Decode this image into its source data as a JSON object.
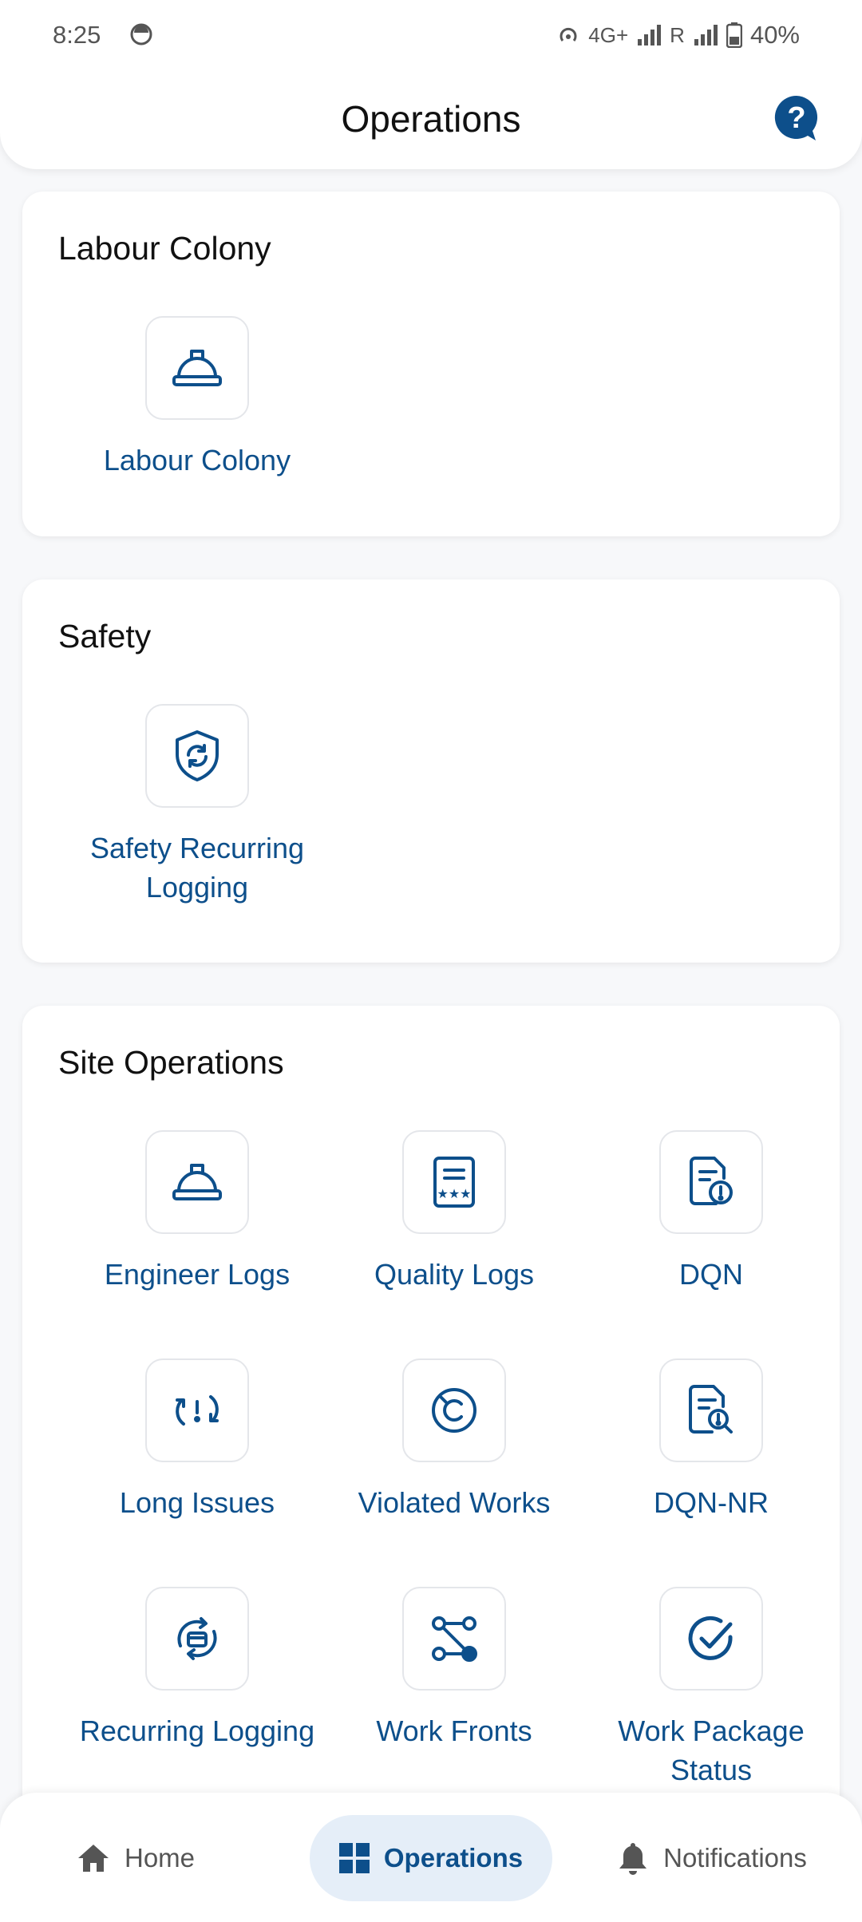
{
  "status_bar": {
    "time": "8:25",
    "network": "4G+",
    "roaming": "R",
    "battery": "40%"
  },
  "header": {
    "title": "Operations",
    "help_icon": "help-icon"
  },
  "sections": {
    "labour": {
      "title": "Labour Colony",
      "items": [
        {
          "label": "Labour Colony",
          "icon": "hard-hat-icon"
        }
      ]
    },
    "safety": {
      "title": "Safety",
      "items": [
        {
          "label": "Safety Recurring Logging",
          "icon": "shield-refresh-icon"
        }
      ]
    },
    "site": {
      "title": "Site Operations",
      "items": [
        {
          "label": "Engineer Logs",
          "icon": "hard-hat-icon"
        },
        {
          "label": "Quality Logs",
          "icon": "rating-document-icon"
        },
        {
          "label": "DQN",
          "icon": "document-alert-icon"
        },
        {
          "label": "Long Issues",
          "icon": "refresh-alert-icon"
        },
        {
          "label": "Violated Works",
          "icon": "copyright-slash-icon"
        },
        {
          "label": "DQN-NR",
          "icon": "document-search-icon"
        },
        {
          "label": "Recurring Logging",
          "icon": "recurring-box-icon"
        },
        {
          "label": "Work Fronts",
          "icon": "flow-nodes-icon"
        },
        {
          "label": "Work Package Status",
          "icon": "check-circle-icon"
        }
      ]
    }
  },
  "bottom_nav": {
    "home": "Home",
    "operations": "Operations",
    "notifications": "Notifications"
  },
  "colors": {
    "accent": "#0d4f8b",
    "active_tab_bg": "#e5eef8",
    "text": "#111111",
    "muted": "#555555"
  }
}
